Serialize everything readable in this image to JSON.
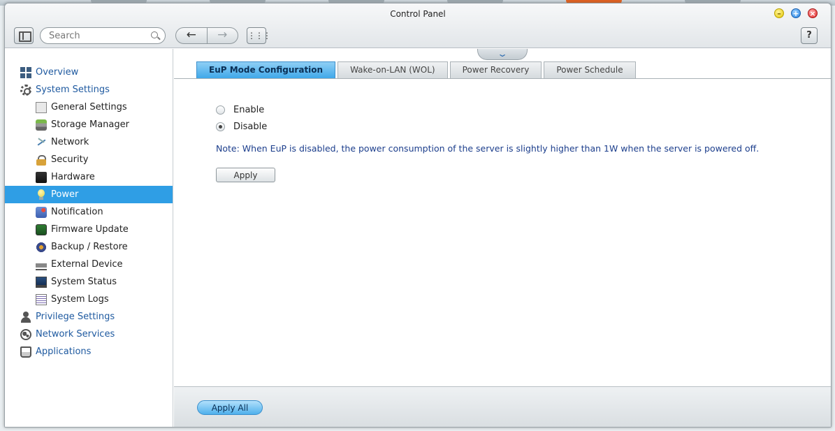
{
  "window": {
    "title": "Control Panel"
  },
  "toolbar": {
    "search_placeholder": "Search",
    "back_label": "←",
    "forward_label": "→",
    "grid_label": "⋮⋮⋮",
    "help_label": "?"
  },
  "sidebar": {
    "overview": "Overview",
    "system_settings": "System Settings",
    "sub_items": [
      {
        "label": "General Settings",
        "icon": "general-settings-icon"
      },
      {
        "label": "Storage Manager",
        "icon": "storage-manager-icon"
      },
      {
        "label": "Network",
        "icon": "network-icon"
      },
      {
        "label": "Security",
        "icon": "lock-icon"
      },
      {
        "label": "Hardware",
        "icon": "hardware-icon"
      },
      {
        "label": "Power",
        "icon": "bulb-icon"
      },
      {
        "label": "Notification",
        "icon": "notification-icon"
      },
      {
        "label": "Firmware Update",
        "icon": "firmware-icon"
      },
      {
        "label": "Backup / Restore",
        "icon": "backup-icon"
      },
      {
        "label": "External Device",
        "icon": "external-device-icon"
      },
      {
        "label": "System Status",
        "icon": "monitor-icon"
      },
      {
        "label": "System Logs",
        "icon": "logs-icon"
      }
    ],
    "privilege_settings": "Privilege Settings",
    "network_services": "Network Services",
    "applications": "Applications"
  },
  "tabs": [
    {
      "label": "EuP Mode Configuration",
      "active": true
    },
    {
      "label": "Wake-on-LAN (WOL)",
      "active": false
    },
    {
      "label": "Power Recovery",
      "active": false
    },
    {
      "label": "Power Schedule",
      "active": false
    }
  ],
  "eup": {
    "enable_label": "Enable",
    "disable_label": "Disable",
    "selected": "Disable",
    "note_prefix": "Note:",
    "note_text": "When EuP is disabled, the power consumption of the server is slightly higher than 1W when the server is powered off.",
    "apply_label": "Apply"
  },
  "footer": {
    "apply_all_label": "Apply All"
  },
  "colors": {
    "accent": "#2f9ee5",
    "link": "#1f5aa0",
    "note": "#1c3e8c"
  }
}
